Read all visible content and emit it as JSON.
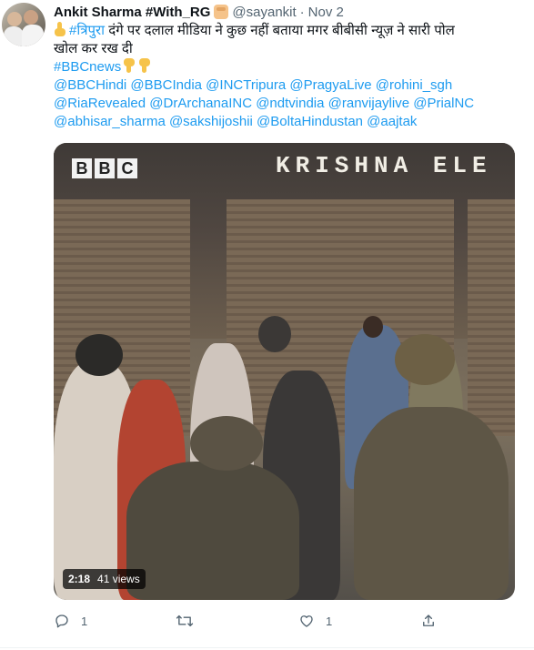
{
  "tweet": {
    "author_name": "Ankit Sharma #With_RG",
    "handle": "@sayankit",
    "separator": "·",
    "date": "Nov 2",
    "text": {
      "hashtag": "#त्रिपुरा",
      "line1_rest": " दंगे पर दलाल मीडिया ने कुछ नहीं बताया मगर बीबीसी न्यूज़ ने सारी पोल",
      "line2": "खोल कर रख दी",
      "hashtag2": "#BBCnews",
      "mentions_line1": "@BBCHindi @BBCIndia @INCTripura @PragyaLive @rohini_sgh",
      "mentions_line2": "@RiaRevealed @DrArchanaINC @ndtvindia @ranvijaylive @PrialNC",
      "mentions_line3": "@abhisar_sharma @sakshijoshii @BoltaHindustan @aajtak"
    },
    "video": {
      "overlay_bbc": [
        "B",
        "B",
        "C"
      ],
      "overlay_sign": "KRISHNA ELE",
      "duration": "2:18",
      "views": "41 views"
    },
    "actions": {
      "reply_count": "1",
      "retweet_count": "",
      "like_count": "1"
    }
  },
  "colors": {
    "link": "#1d9bf0",
    "muted": "#536471",
    "text": "#0f1419"
  },
  "icons": [
    "fist-emoji-icon",
    "pointing-up-emoji-icon",
    "pointing-down-emoji-icon",
    "reply-icon",
    "retweet-icon",
    "like-icon",
    "share-icon"
  ]
}
